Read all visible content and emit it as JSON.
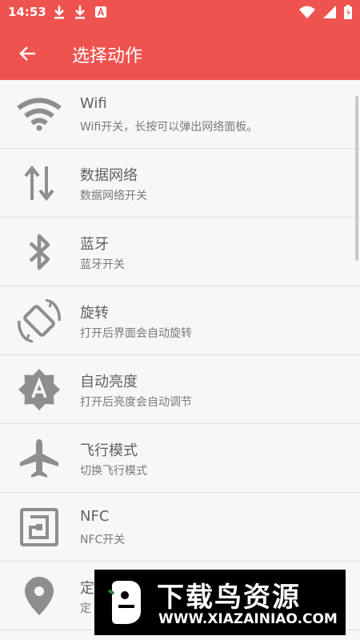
{
  "status_bar": {
    "time": "14:53"
  },
  "app_bar": {
    "title": "选择动作"
  },
  "items": [
    {
      "title": "Wifi",
      "subtitle": "Wifi开关，长按可以弹出网络面板。",
      "icon": "wifi-icon"
    },
    {
      "title": "数据网络",
      "subtitle": "数据网络开关",
      "icon": "data-arrows-icon"
    },
    {
      "title": "蓝牙",
      "subtitle": "蓝牙开关",
      "icon": "bluetooth-icon"
    },
    {
      "title": "旋转",
      "subtitle": "打开后界面会自动旋转",
      "icon": "rotation-icon"
    },
    {
      "title": "自动亮度",
      "subtitle": "打开后亮度会自动调节",
      "icon": "auto-brightness-icon"
    },
    {
      "title": "飞行模式",
      "subtitle": "切换飞行模式",
      "icon": "airplane-icon"
    },
    {
      "title": "NFC",
      "subtitle": "NFC开关",
      "icon": "nfc-icon"
    },
    {
      "title": "定",
      "subtitle": "定",
      "icon": "location-icon"
    }
  ],
  "watermark": {
    "title": "下载鸟资源",
    "url": "WWW.XIAZAINIAO.COM"
  },
  "colors": {
    "primary": "#ef5350",
    "icon_gray": "#8e8e8e",
    "title_text": "#616161",
    "subtitle_text": "#7a7a7a"
  }
}
